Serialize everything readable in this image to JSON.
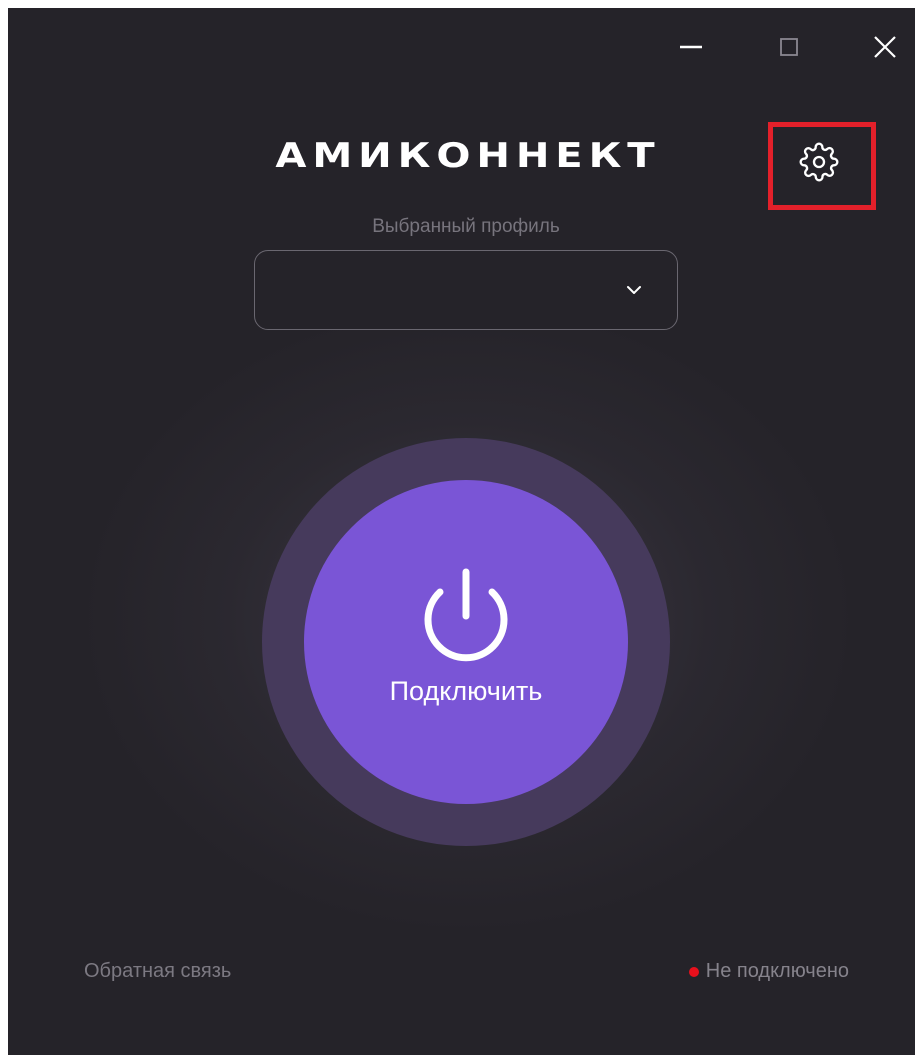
{
  "window_controls": {
    "minimize": "minimize-icon",
    "maximize": "maximize-icon",
    "close": "close-icon"
  },
  "header": {
    "logo_text": "АМИКОННЕКТ",
    "settings_icon": "gear-icon"
  },
  "profile": {
    "label": "Выбранный профиль",
    "selected_value": ""
  },
  "connect": {
    "label": "Подключить",
    "icon": "power-icon"
  },
  "footer": {
    "feedback_link": "Обратная связь",
    "status_text": "Не подключено"
  },
  "colors": {
    "background": "#252329",
    "accent": "#7a55d6",
    "ring": "#463a5c",
    "status_disconnected": "#e8101c",
    "highlight": "#e3202a"
  }
}
